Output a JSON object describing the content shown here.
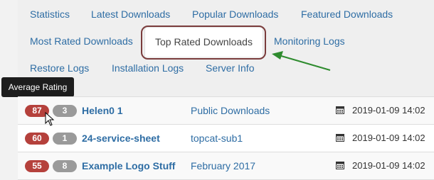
{
  "tabs": [
    {
      "label": "Statistics"
    },
    {
      "label": "Latest Downloads"
    },
    {
      "label": "Popular Downloads"
    },
    {
      "label": "Featured Downloads"
    },
    {
      "label": "Most Rated Downloads"
    },
    {
      "label": "Top Rated Downloads"
    },
    {
      "label": "Monitoring Logs"
    },
    {
      "label": "Restore Logs"
    },
    {
      "label": "Installation Logs"
    },
    {
      "label": "Server Info"
    }
  ],
  "active_tab": "Top Rated Downloads",
  "tooltip": {
    "text": "Average Rating"
  },
  "rows": [
    {
      "rating": "87",
      "count": "3",
      "title": "Helen0 1",
      "category": "Public Downloads",
      "date": "2019-01-09 14:02"
    },
    {
      "rating": "60",
      "count": "1",
      "title": "24-service-sheet",
      "category": "topcat-sub1",
      "date": "2019-01-09 14:02"
    },
    {
      "rating": "55",
      "count": "8",
      "title": "Example Logo Stuff",
      "category": "February 2017",
      "date": "2019-01-09 14:02"
    }
  ],
  "colors": {
    "link": "#2e6da4",
    "rating_badge": "#b5413c",
    "count_badge": "#9a9a9a",
    "highlight_border": "#7a3c3c",
    "arrow": "#2e8b2e"
  }
}
